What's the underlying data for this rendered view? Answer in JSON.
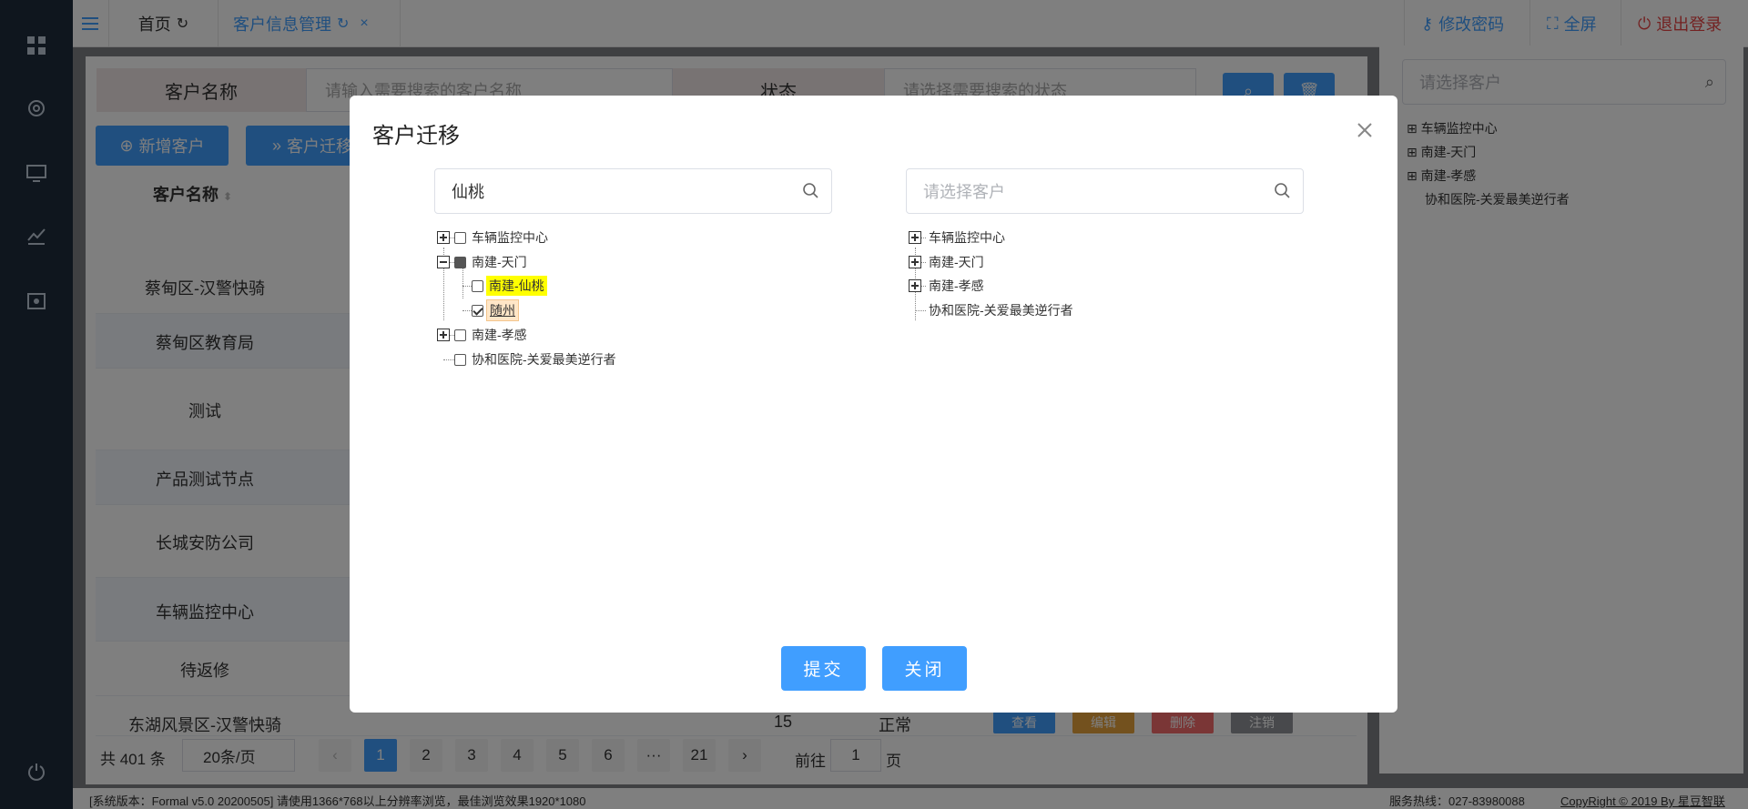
{
  "topbar": {
    "home_tab": "首页",
    "active_tab": "客户信息管理",
    "tab_close": "×",
    "change_password": "修改密码",
    "fullscreen": "全屏",
    "logout": "退出登录"
  },
  "search_bar": {
    "name_label": "客户名称",
    "name_placeholder": "请输入需要搜索的客户名称",
    "status_label": "状态",
    "status_placeholder": "请选择需要搜索的状态"
  },
  "toolbar": {
    "add_customer": "新增客户",
    "migrate_customer": "客户迁移"
  },
  "table": {
    "header_name": "客户名称",
    "rows": [
      "蔡甸区-汉警快骑",
      "蔡甸区教育局",
      "测试",
      "产品测试节点",
      "长城安防公司",
      "车辆监控中心",
      "待返修",
      "东湖风景区-汉警快骑"
    ],
    "last_row_count": "15",
    "last_row_status": "正常",
    "op_view": "查看",
    "op_edit": "编辑",
    "op_delete": "删除",
    "op_cancel": "注销"
  },
  "pagination": {
    "total": "共 401 条",
    "page_size": "20条/页",
    "pages": [
      "1",
      "2",
      "3",
      "4",
      "5",
      "6",
      "···",
      "21"
    ],
    "goto_label": "前往",
    "goto_value": "1",
    "goto_suffix": "页"
  },
  "right_panel": {
    "search_placeholder": "请选择客户",
    "tree": [
      "车辆监控中心",
      "南建-天门",
      "南建-孝感",
      "协和医院-关爱最美逆行者"
    ]
  },
  "footer": {
    "version": "[系统版本：Formal v5.0 20200505] 请使用1366*768以上分辨率浏览，最佳浏览效果1920*1080",
    "hotline": "服务热线：027-83980088",
    "copyright": "CopyRight © 2019 By 星豆智联"
  },
  "modal": {
    "title": "客户迁移",
    "left_search_value": "仙桃",
    "right_search_placeholder": "请选择客户",
    "left_tree": {
      "n1": "车辆监控中心",
      "n2": "南建-天门",
      "n2a": "南建-仙桃",
      "n2b": "随州",
      "n3": "南建-孝感",
      "n4": "协和医院-关爱最美逆行者"
    },
    "right_tree": {
      "n1": "车辆监控中心",
      "n2": "南建-天门",
      "n3": "南建-孝感",
      "n4": "协和医院-关爱最美逆行者"
    },
    "submit_label": "提交",
    "close_label": "关闭"
  },
  "colors": {
    "accent": "#409eff",
    "highlight": "#ffff00"
  }
}
